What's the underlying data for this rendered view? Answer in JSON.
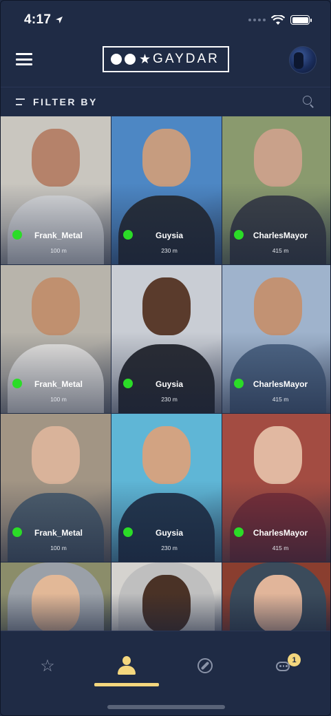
{
  "status_bar": {
    "time": "4:17"
  },
  "header": {
    "logo_text": "GAYDAR"
  },
  "filter": {
    "label": "FILTER BY"
  },
  "profiles": [
    {
      "name": "Frank_Metal",
      "distance": "100 m",
      "online": true,
      "bg": "#c9c6bf",
      "skin": "#b5826a",
      "top": "#d9dadb"
    },
    {
      "name": "Guysia",
      "distance": "230 m",
      "online": true,
      "bg": "#4d87c4",
      "skin": "#c69c7f",
      "top": "#28303b"
    },
    {
      "name": "CharlesMayor",
      "distance": "415 m",
      "online": true,
      "bg": "#8a9a6e",
      "skin": "#c9a18a",
      "top": "#3d4248"
    },
    {
      "name": "Frank_Metal",
      "distance": "100 m",
      "online": true,
      "bg": "#b8b4ab",
      "skin": "#c0906f",
      "top": "#e8e6e2"
    },
    {
      "name": "Guysia",
      "distance": "230 m",
      "online": true,
      "bg": "#c9cdd4",
      "skin": "#5a3b2c",
      "top": "#2b2d33"
    },
    {
      "name": "CharlesMayor",
      "distance": "415 m",
      "online": true,
      "bg": "#9fb3cc",
      "skin": "#c29273",
      "top": "#4f6786"
    },
    {
      "name": "Frank_Metal",
      "distance": "100 m",
      "online": true,
      "bg": "#a29584",
      "skin": "#d9b39a",
      "top": "#4e5f6e"
    },
    {
      "name": "Guysia",
      "distance": "230 m",
      "online": true,
      "bg": "#5fb6d6",
      "skin": "#d2a382",
      "top": "#24384f"
    },
    {
      "name": "CharlesMayor",
      "distance": "415 m",
      "online": true,
      "bg": "#a34c42",
      "skin": "#e1b8a1",
      "top": "#7a2f38"
    },
    {
      "name": "",
      "distance": "",
      "online": false,
      "bg": "#8b8d6a",
      "skin": "#e2b897",
      "top": "#9aa0a8"
    },
    {
      "name": "",
      "distance": "",
      "online": false,
      "bg": "#d5d3cf",
      "skin": "#4a3226",
      "top": "#bfbfbf"
    },
    {
      "name": "",
      "distance": "",
      "online": false,
      "bg": "#8a3e2f",
      "skin": "#e1b59a",
      "top": "#3b4b5b"
    }
  ],
  "tabs": {
    "chat_badge": "1"
  },
  "colors": {
    "background": "#1f2b45",
    "accent": "#f4d77e",
    "online": "#2bdc27"
  }
}
